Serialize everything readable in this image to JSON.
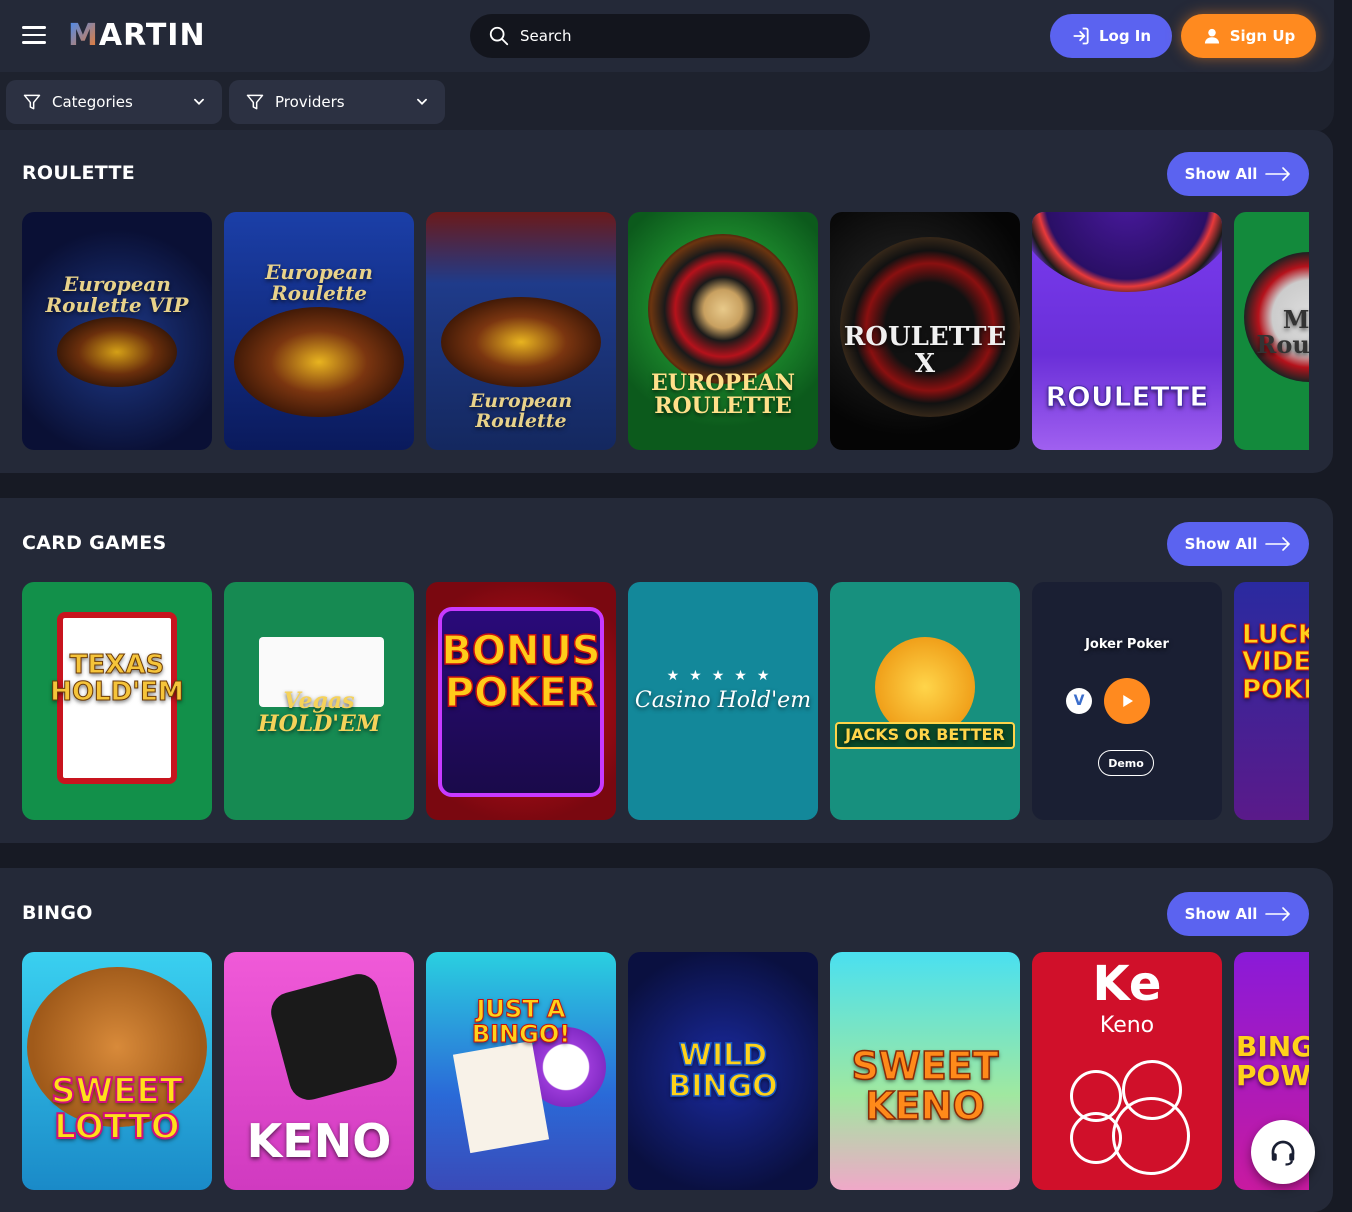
{
  "header": {
    "logo": "MARTIN",
    "logo_first": "M",
    "logo_rest": "ARTIN",
    "search_placeholder": "Search",
    "login_label": "Log In",
    "signup_label": "Sign Up",
    "filters": [
      {
        "label": "Categories"
      },
      {
        "label": "Providers"
      }
    ]
  },
  "sections": [
    {
      "title": "ROULETTE",
      "show_all": "Show All",
      "games": [
        {
          "name": "European Roulette VIP"
        },
        {
          "name": "European Roulette"
        },
        {
          "name": "European Roulette"
        },
        {
          "name": "EUROPEAN ROULETTE"
        },
        {
          "name": "ROULETTE X"
        },
        {
          "name": "ROULETTE"
        },
        {
          "name": "Mini Roulette"
        }
      ]
    },
    {
      "title": "CARD GAMES",
      "show_all": "Show All",
      "games": [
        {
          "name": "TEXAS HOLD'EM"
        },
        {
          "name": "Vegas HOLD'EM"
        },
        {
          "name": "BONUS POKER"
        },
        {
          "name": "Casino Hold'em"
        },
        {
          "name": "JACKS OR BETTER"
        },
        {
          "name": "Joker Poker",
          "demo": "Demo"
        },
        {
          "name": "LUCKY VIDEO POKER"
        }
      ]
    },
    {
      "title": "BINGO",
      "show_all": "Show All",
      "games": [
        {
          "name": "SWEET LOTTO"
        },
        {
          "name": "KENO"
        },
        {
          "name": "JUST A BINGO!"
        },
        {
          "name": "WILD BINGO"
        },
        {
          "name": "SWEET KENO"
        },
        {
          "name": "Keno"
        },
        {
          "name": "BINGO POWER"
        }
      ]
    }
  ],
  "colors": {
    "background": "#171a24",
    "panel": "#242938",
    "accent_blue": "#5b63f0",
    "accent_orange": "#ff8a1f"
  }
}
